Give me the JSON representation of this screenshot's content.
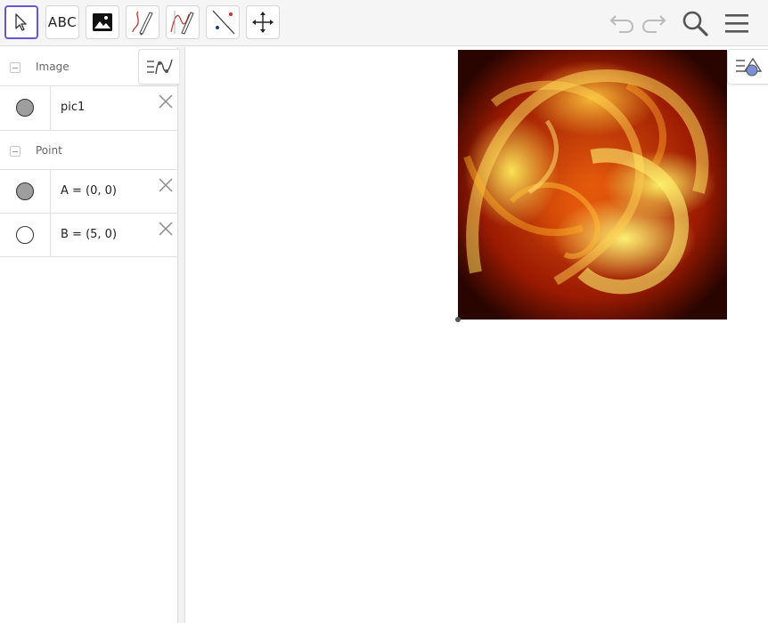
{
  "toolbar": {
    "tools": [
      "move",
      "text",
      "image",
      "pen",
      "freehand-function",
      "point-on-object",
      "move-graphics-view"
    ],
    "text_tool_label": "ABC",
    "active_tool": "move",
    "accent_color": "#6557d2"
  },
  "algebra": {
    "groups": [
      {
        "label": "Image",
        "items": [
          {
            "value": "pic1",
            "marble": "filled"
          }
        ]
      },
      {
        "label": "Point",
        "items": [
          {
            "value": "A = (0, 0)",
            "marble": "filled"
          },
          {
            "value": "B = (5, 0)",
            "marble": "empty"
          }
        ]
      }
    ]
  },
  "graphics": {
    "image_name": "pic1",
    "image_description": "fire/flame image"
  }
}
